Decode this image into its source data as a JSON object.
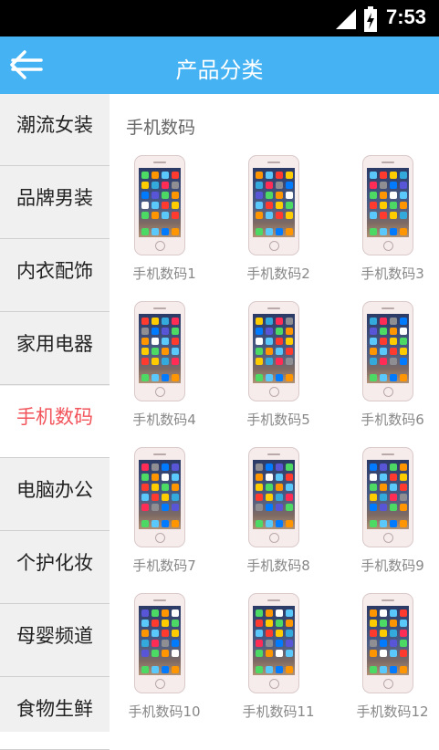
{
  "status_bar": {
    "time": "7:53"
  },
  "header": {
    "title": "产品分类"
  },
  "sidebar": {
    "items": [
      {
        "label": "潮流女装",
        "active": false
      },
      {
        "label": "品牌男装",
        "active": false
      },
      {
        "label": "内衣配饰",
        "active": false
      },
      {
        "label": "家用电器",
        "active": false
      },
      {
        "label": "手机数码",
        "active": true
      },
      {
        "label": "电脑办公",
        "active": false
      },
      {
        "label": "个护化妆",
        "active": false
      },
      {
        "label": "母婴频道",
        "active": false
      },
      {
        "label": "食物生鲜",
        "active": false
      }
    ]
  },
  "main": {
    "section_title": "手机数码",
    "products": [
      {
        "label": "手机数码1"
      },
      {
        "label": "手机数码2"
      },
      {
        "label": "手机数码3"
      },
      {
        "label": "手机数码4"
      },
      {
        "label": "手机数码5"
      },
      {
        "label": "手机数码6"
      },
      {
        "label": "手机数码7"
      },
      {
        "label": "手机数码8"
      },
      {
        "label": "手机数码9"
      },
      {
        "label": "手机数码10"
      },
      {
        "label": "手机数码11"
      },
      {
        "label": "手机数码12"
      }
    ]
  },
  "icons": {
    "back": "arrow-left-icon",
    "signal": "signal-icon",
    "battery": "battery-icon",
    "product": "phone-icon"
  },
  "colors": {
    "header_bg": "#45b3f3",
    "active_item": "#f2545b",
    "sidebar_bg": "#f0f0f0"
  }
}
